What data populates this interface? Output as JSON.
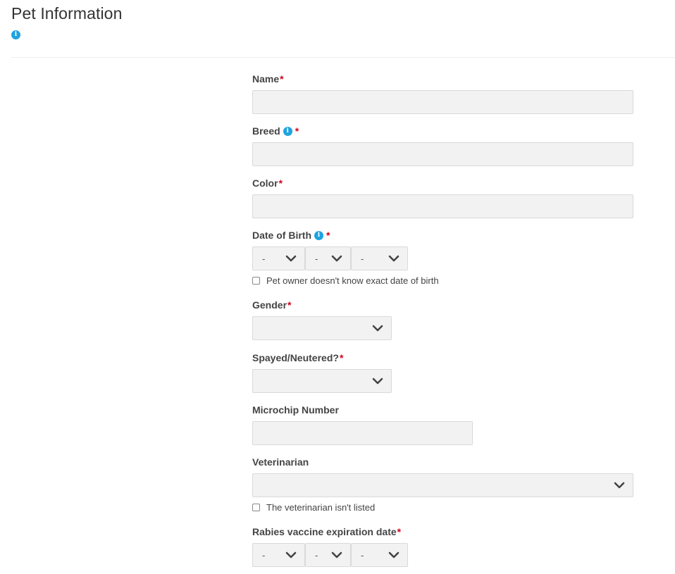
{
  "header": {
    "title": "Pet Information",
    "info_icon": "info-icon"
  },
  "colors": {
    "accent_info": "#1fa3e0",
    "required": "#d0021b",
    "input_bg": "#f2f2f2"
  },
  "form": {
    "name": {
      "label": "Name",
      "required": "*",
      "value": ""
    },
    "breed": {
      "label": "Breed",
      "required": "*",
      "value": ""
    },
    "color": {
      "label": "Color",
      "required": "*",
      "value": ""
    },
    "date_of_birth": {
      "label": "Date of Birth",
      "required": "*",
      "month": "-",
      "day": "-",
      "year": "-",
      "unknown_checkbox_label": "Pet owner doesn't know exact date of birth",
      "unknown_checked": false
    },
    "gender": {
      "label": "Gender",
      "required": "*",
      "value": ""
    },
    "spayed_neutered": {
      "label": "Spayed/Neutered?",
      "required": "*",
      "value": ""
    },
    "microchip": {
      "label": "Microchip Number",
      "value": ""
    },
    "veterinarian": {
      "label": "Veterinarian",
      "value": "",
      "not_listed_checkbox_label": "The veterinarian isn't listed",
      "not_listed_checked": false
    },
    "rabies_expiration": {
      "label": "Rabies vaccine expiration date",
      "required": "*",
      "month": "-",
      "day": "-",
      "year": "-"
    }
  }
}
